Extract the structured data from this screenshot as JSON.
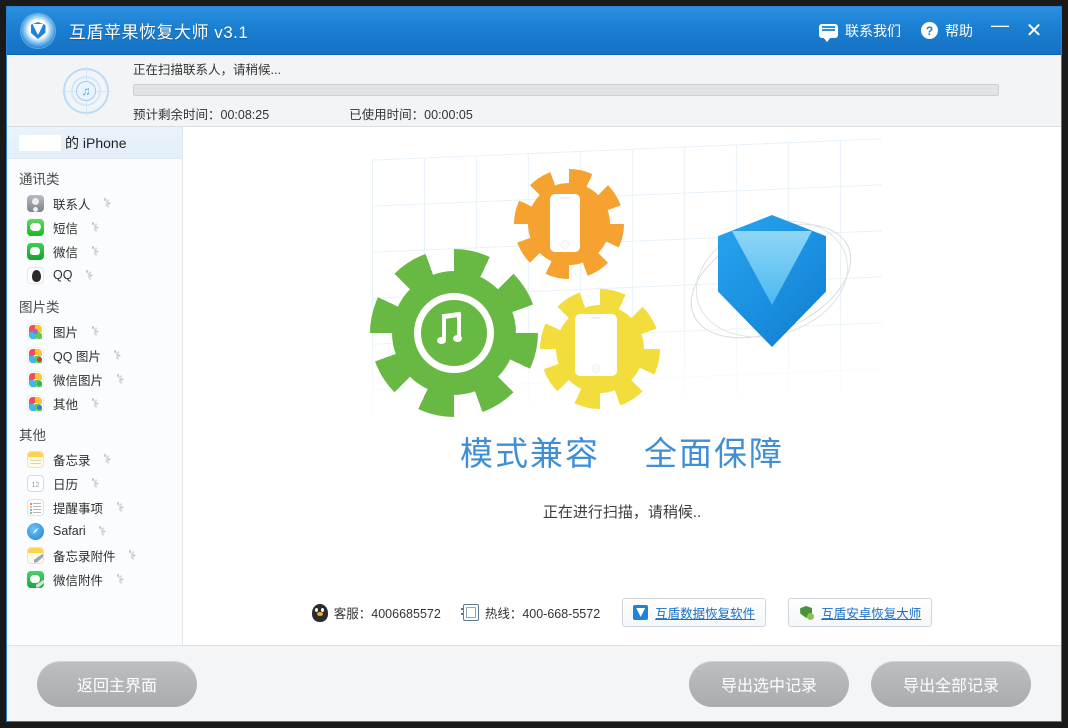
{
  "titlebar": {
    "app_title": "互盾苹果恢复大师 v3.1",
    "contact_label": "联系我们",
    "help_label": "帮助",
    "minimize_label": "—",
    "close_label": "✕",
    "accent_color": "#1a7ed0"
  },
  "progress": {
    "status_text": "正在扫描联系人，请稍候...",
    "percent": 0,
    "remaining_label": "预计剩余时间：00:08:25",
    "elapsed_label": "已使用时间：00:00:05"
  },
  "sidebar": {
    "device_name": "的 iPhone",
    "groups": [
      {
        "title": "通讯类",
        "items": [
          {
            "label": "联系人",
            "icon": "contacts-icon"
          },
          {
            "label": "短信",
            "icon": "sms-icon"
          },
          {
            "label": "微信",
            "icon": "wechat-icon"
          },
          {
            "label": "QQ",
            "icon": "qq-icon"
          }
        ]
      },
      {
        "title": "图片类",
        "items": [
          {
            "label": "图片",
            "icon": "photos-icon"
          },
          {
            "label": "QQ 图片",
            "icon": "qq-photos-icon"
          },
          {
            "label": "微信图片",
            "icon": "wechat-photos-icon"
          },
          {
            "label": "其他",
            "icon": "other-photos-icon"
          }
        ]
      },
      {
        "title": "其他",
        "items": [
          {
            "label": "备忘录",
            "icon": "notes-icon"
          },
          {
            "label": "日历",
            "icon": "calendar-icon"
          },
          {
            "label": "提醒事项",
            "icon": "reminders-icon"
          },
          {
            "label": "Safari",
            "icon": "safari-icon"
          },
          {
            "label": "备忘录附件",
            "icon": "notes-attachment-icon"
          },
          {
            "label": "微信附件",
            "icon": "wechat-attachment-icon"
          }
        ]
      }
    ]
  },
  "content": {
    "slogan_left": "模式兼容",
    "slogan_right": "全面保障",
    "scan_note": "正在进行扫描，请稍候..",
    "slogan_color": "#3f8ed6"
  },
  "infobar": {
    "service_label": "客服：4006685572",
    "hotline_label": "热线：400-668-5572",
    "promo_one": "互盾数据恢复软件",
    "promo_two": "互盾安卓恢复大师",
    "link_color": "#1a6fc4"
  },
  "footer": {
    "back_label": "返回主界面",
    "export_selected_label": "导出选中记录",
    "export_all_label": "导出全部记录"
  },
  "calendar_icon_day": "12"
}
